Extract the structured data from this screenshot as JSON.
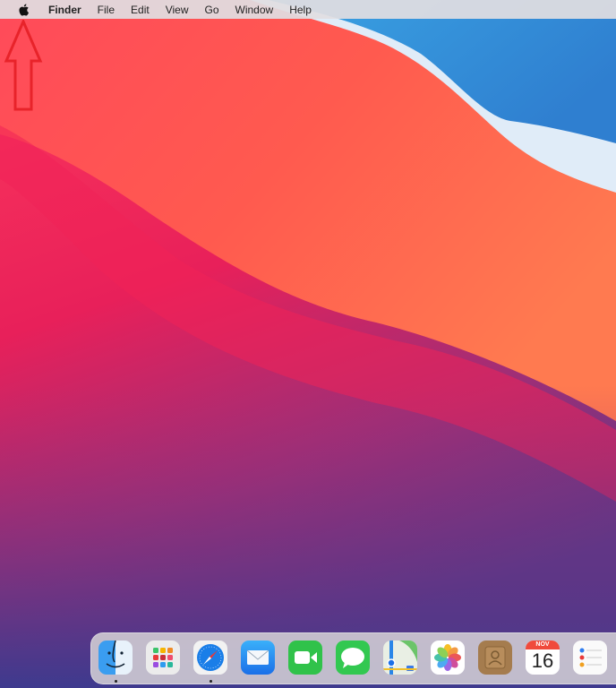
{
  "menubar": {
    "apple_icon": "apple-logo",
    "items": [
      "Finder",
      "File",
      "Edit",
      "View",
      "Go",
      "Window",
      "Help"
    ]
  },
  "annotation": {
    "icon": "up-arrow-outline",
    "color": "#e8232a"
  },
  "dock": {
    "apps": [
      {
        "name": "Finder",
        "running": true
      },
      {
        "name": "Launchpad",
        "running": false
      },
      {
        "name": "Safari",
        "running": true
      },
      {
        "name": "Mail",
        "running": false
      },
      {
        "name": "FaceTime",
        "running": false
      },
      {
        "name": "Messages",
        "running": false
      },
      {
        "name": "Maps",
        "running": false
      },
      {
        "name": "Photos",
        "running": false
      },
      {
        "name": "Contacts",
        "running": false
      },
      {
        "name": "Calendar",
        "running": false
      },
      {
        "name": "Reminders",
        "running": false
      }
    ],
    "calendar": {
      "month": "NOV",
      "day": "16"
    }
  }
}
